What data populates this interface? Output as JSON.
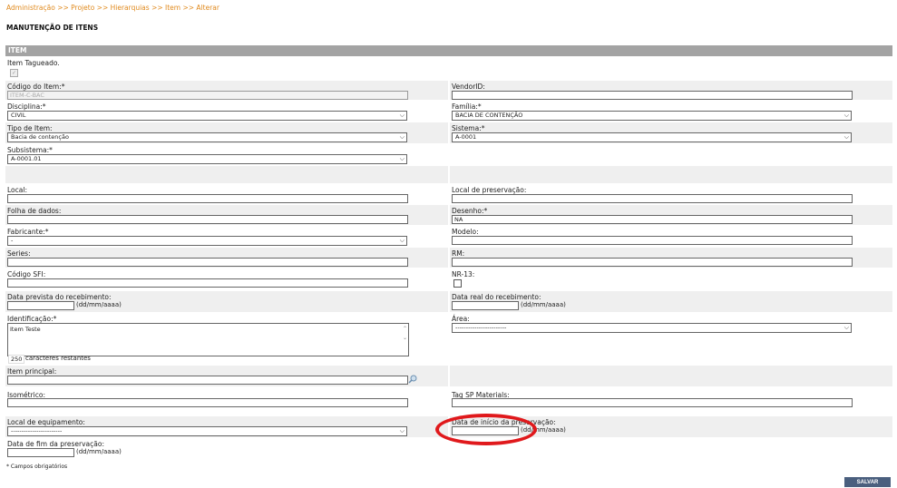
{
  "breadcrumb": "Administração >> Projeto >> Hierarquias >> Item >> Alterar",
  "page_title": "MANUTENÇÃO DE ITENS",
  "section_header": "ITEM",
  "form": {
    "item_tagueado_label": "Item Tagueado.",
    "item_tagueado_checked": "✓",
    "codigo_item_label": "Código do Item:*",
    "codigo_item_value": "ITEM-C-BAC",
    "vendor_id_label": "VendorID:",
    "disciplina_label": "Disciplina:*",
    "disciplina_value": "CIVIL",
    "familia_label": "Família:*",
    "familia_value": "BACIA DE CONTENÇÃO",
    "tipo_item_label": "Tipo de Item:",
    "tipo_item_value": "Bacia de contenção",
    "sistema_label": "Sistema:*",
    "sistema_value": "A-0001",
    "subsistema_label": "Subsistema:*",
    "subsistema_value": "A-0001.01",
    "local_label": "Local:",
    "local_preservacao_label": "Local de preservação:",
    "folha_dados_label": "Folha de dados:",
    "desenho_label": "Desenho:*",
    "desenho_value": "NA",
    "fabricante_label": "Fabricante:*",
    "fabricante_value": "-",
    "modelo_label": "Modelo:",
    "series_label": "Series:",
    "rm_label": "RM:",
    "codigo_sfi_label": "Código SFI:",
    "nr13_label": "NR-13:",
    "data_prevista_label": "Data prevista do recebimento:",
    "data_real_label": "Data real do recebimento:",
    "date_hint": "(dd/mm/aaaa)",
    "identificacao_label": "Identificação:*",
    "identificacao_value": "Item Teste",
    "area_label": "Área:",
    "area_value": "------------------------",
    "chars_count": "250",
    "chars_label": "caracteres restantes",
    "item_principal_label": "Item principal:",
    "isometrico_label": "Isométrico:",
    "tag_sp_label": "Tag SP Materials:",
    "local_equip_label": "Local de equipamento:",
    "local_equip_value": "------------------------",
    "data_inicio_label": "Data de início da preservação:",
    "data_fim_label": "Data de fim da preservação:"
  },
  "required_note": "* Campos obrigatórios",
  "save_label": "SALVAR",
  "colors": {
    "breadcrumb": "#e08a1e",
    "header": "#a3a3a3",
    "save_button": "#4a5f7e",
    "highlight": "#e0191c"
  },
  "icons": {
    "lookup": "magnifier-icon",
    "select": "chevron-down-icon"
  }
}
